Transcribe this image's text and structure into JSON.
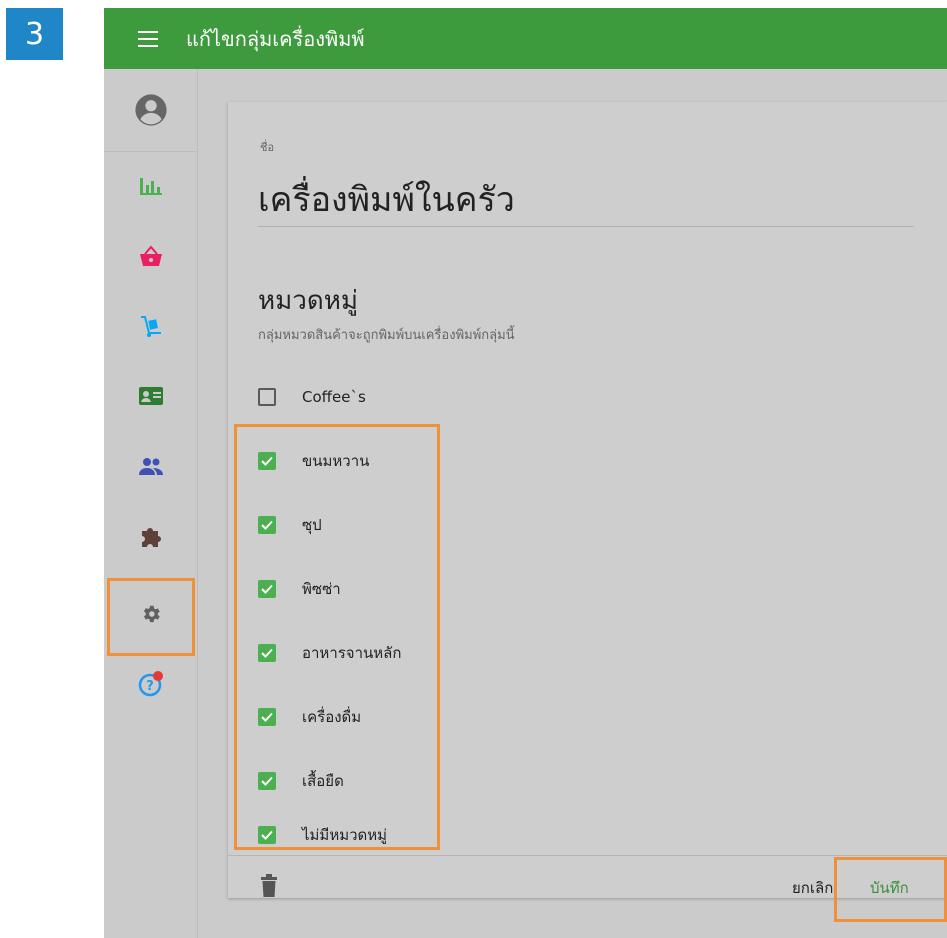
{
  "step_badge": "3",
  "header": {
    "title": "แก้ไขกลุ่มเครื่องพิมพ์"
  },
  "sidebar": {
    "items": [
      {
        "icon": "account-circle-icon",
        "color": "#666666"
      },
      {
        "icon": "bar-chart-icon",
        "color": "#4caf50"
      },
      {
        "icon": "basket-icon",
        "color": "#e91e63"
      },
      {
        "icon": "hand-truck-icon",
        "color": "#03a9f4"
      },
      {
        "icon": "contact-card-icon",
        "color": "#2e7d32"
      },
      {
        "icon": "people-icon",
        "color": "#3f51b5"
      },
      {
        "icon": "puzzle-icon",
        "color": "#5d4037"
      },
      {
        "icon": "gear-icon",
        "color": "#616161"
      },
      {
        "icon": "help-circle-icon",
        "color": "#2196f3"
      }
    ]
  },
  "form": {
    "name_label": "ชื่อ",
    "name_value": "เครื่องพิมพ์ในครัว",
    "categories_title": "หมวดหมู่",
    "categories_desc": "กลุ่มหมวดสินค้าจะถูกพิมพ์บนเครื่องพิมพ์กลุ่มนี้",
    "categories": [
      {
        "label": "Coffee`s",
        "checked": false
      },
      {
        "label": "ขนมหวาน",
        "checked": true
      },
      {
        "label": "ซุป",
        "checked": true
      },
      {
        "label": "พิซซ่า",
        "checked": true
      },
      {
        "label": "อาหารจานหลัก",
        "checked": true
      },
      {
        "label": "เครื่องดื่ม",
        "checked": true
      },
      {
        "label": "เสื้อยืด",
        "checked": true
      },
      {
        "label": "ไม่มีหมวดหมู่",
        "checked": true
      }
    ]
  },
  "actions": {
    "cancel_label": "ยกเลิก",
    "save_label": "บันทึก"
  },
  "colors": {
    "header": "#3e9b3d",
    "checkbox_checked": "#4caf50",
    "highlight": "#f0903a",
    "badge": "#1f86c8"
  }
}
